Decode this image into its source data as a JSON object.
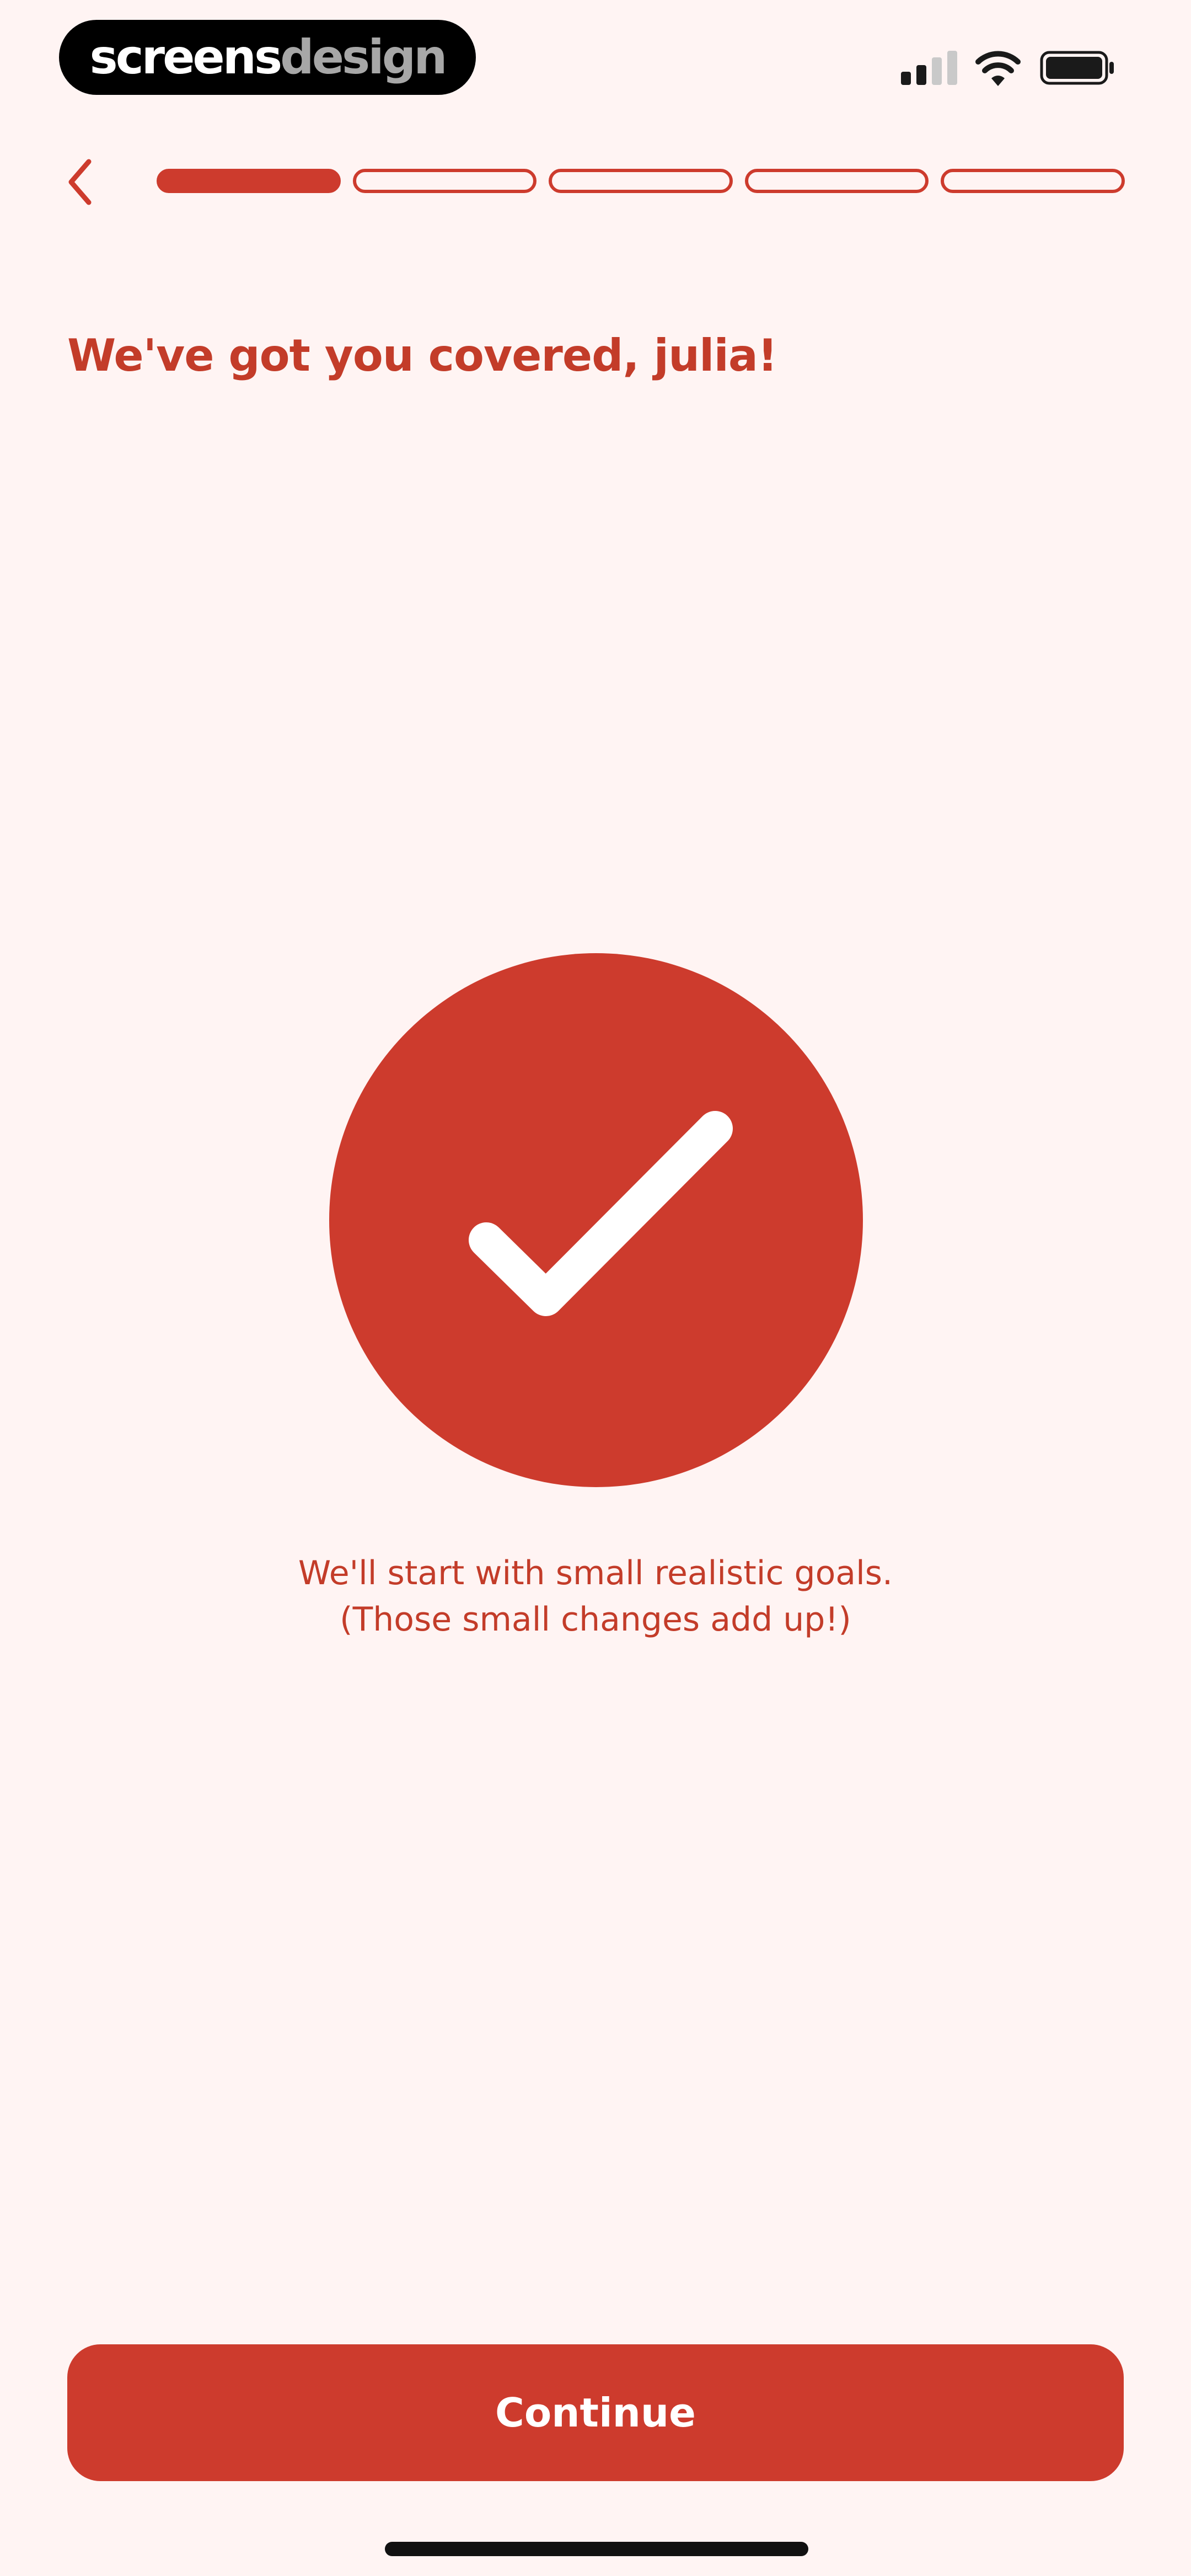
{
  "status_bar": {
    "brand_primary": "screens",
    "brand_secondary": "design",
    "signal_icon": "cellular-signal-icon",
    "wifi_icon": "wifi-icon",
    "battery_icon": "battery-icon"
  },
  "nav": {
    "back_icon": "chevron-left-icon",
    "progress": {
      "current_step": 1,
      "total_steps": 5
    }
  },
  "title": "We've got you covered, julia!",
  "hero_icon": "checkmark-icon",
  "message": {
    "line1": "We'll start with small realistic goals.",
    "line2": "(Those small changes add up!)"
  },
  "continue_label": "Continue",
  "colors": {
    "accent": "#cd3b2d",
    "text_accent": "#c33c29",
    "background": "#fff4f3"
  }
}
